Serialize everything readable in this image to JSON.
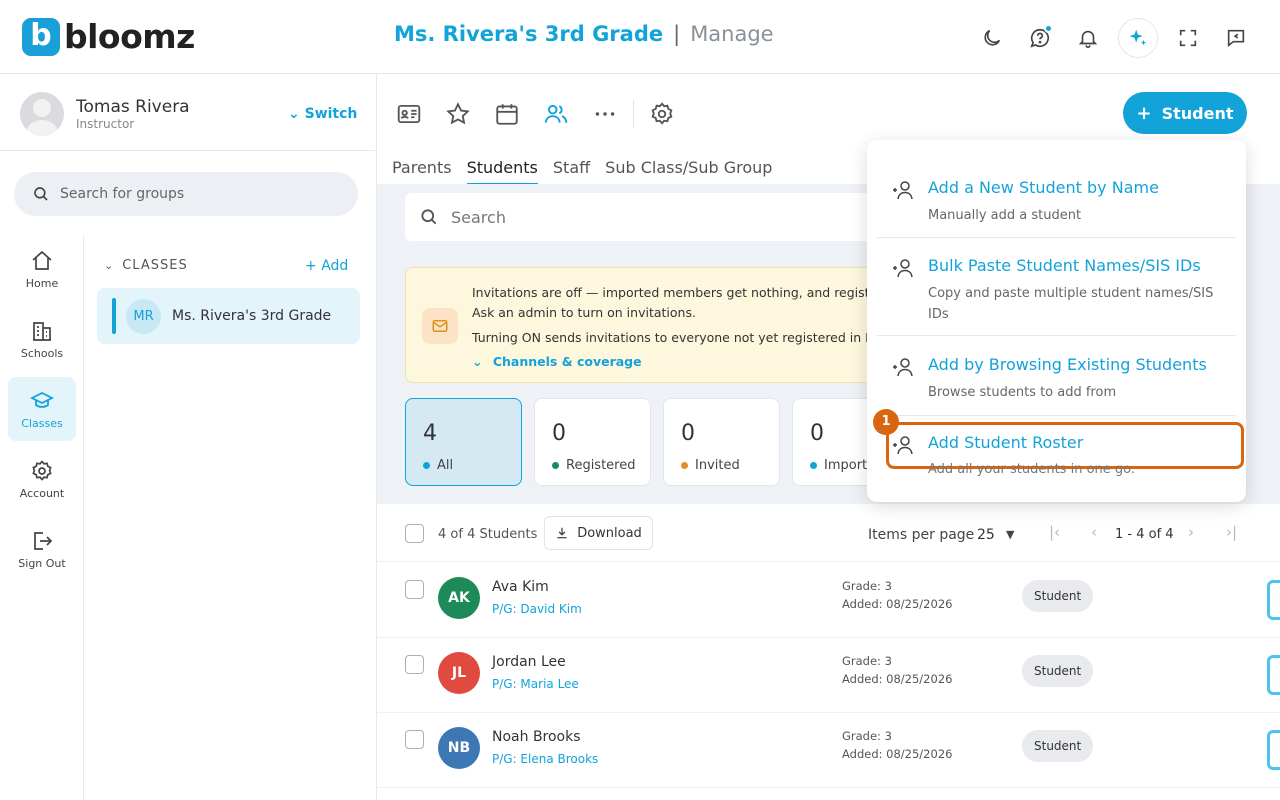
{
  "app": {
    "brand_letter": "b",
    "brand_name": "bloomz"
  },
  "header": {
    "class_name": "Ms. Rivera's 3rd Grade",
    "separator": "|",
    "section": "Manage",
    "icons": [
      "moon-icon",
      "help-chat-icon",
      "bell-icon",
      "sparkle-icon",
      "fullscreen-icon",
      "feedback-icon"
    ]
  },
  "user": {
    "name": "Tomas Rivera",
    "role": "Instructor",
    "switch_label": "Switch"
  },
  "sidebar": {
    "search_placeholder": "Search for groups",
    "nav": [
      {
        "label": "Home",
        "icon": "home-icon"
      },
      {
        "label": "Schools",
        "icon": "building-icon"
      },
      {
        "label": "Classes",
        "icon": "graduation-cap-icon",
        "active": true
      },
      {
        "label": "Account",
        "icon": "gear-icon"
      },
      {
        "label": "Sign Out",
        "icon": "sign-out-icon"
      }
    ],
    "classes_header": "CLASSES",
    "add_label": "Add",
    "class_item": {
      "initials": "MR",
      "name": "Ms. Rivera's 3rd Grade"
    }
  },
  "toolbar": {
    "add_student_label": "Student",
    "add_student_plus": "+"
  },
  "tabs": [
    {
      "label": "Parents"
    },
    {
      "label": "Students",
      "active": true
    },
    {
      "label": "Staff"
    },
    {
      "label": "Sub Class/Sub Group"
    }
  ],
  "search": {
    "placeholder": "Search"
  },
  "notice": {
    "line1": "Invitations are off — imported members get nothing, and registe",
    "line2": "Ask an admin to turn on invitations.",
    "line3": "Turning ON sends invitations to everyone not yet registered in Ms.",
    "link": "Channels & coverage"
  },
  "stats": [
    {
      "value": "4",
      "label": "All",
      "color": "#12a3d9"
    },
    {
      "value": "0",
      "label": "Registered",
      "color": "#1e8a5a"
    },
    {
      "value": "0",
      "label": "Invited",
      "color": "#e0901e"
    },
    {
      "value": "0",
      "label": "Importe",
      "color": "#12a3d9"
    }
  ],
  "list": {
    "count": "4 of 4 Students",
    "download_label": "Download",
    "items_per_page_label": "Items per page",
    "items_per_page_value": "25",
    "range": "1 - 4 of 4"
  },
  "students": [
    {
      "initials": "AK",
      "name": "Ava Kim",
      "pg": "P/G: David Kim",
      "grade": "Grade: 3",
      "added": "Added: 08/25/2026",
      "role": "Student",
      "color": "#1e8a5a"
    },
    {
      "initials": "JL",
      "name": "Jordan Lee",
      "pg": "P/G: Maria Lee",
      "grade": "Grade: 3",
      "added": "Added: 08/25/2026",
      "role": "Student",
      "color": "#e04a3f"
    },
    {
      "initials": "NB",
      "name": "Noah Brooks",
      "pg": "P/G: Elena Brooks",
      "grade": "Grade: 3",
      "added": "Added: 08/25/2026",
      "role": "Student",
      "color": "#3d78b5"
    }
  ],
  "dropdown": [
    {
      "title": "Add a New Student by Name",
      "desc": "Manually add a student"
    },
    {
      "title": "Bulk Paste Student Names/SIS IDs",
      "desc": "Copy and paste multiple student names/SIS IDs"
    },
    {
      "title": "Add by Browsing Existing Students",
      "desc": "Browse students to add from"
    },
    {
      "title": "Add Student Roster",
      "desc": "Add all your students in one go."
    }
  ],
  "step_badge": "1"
}
